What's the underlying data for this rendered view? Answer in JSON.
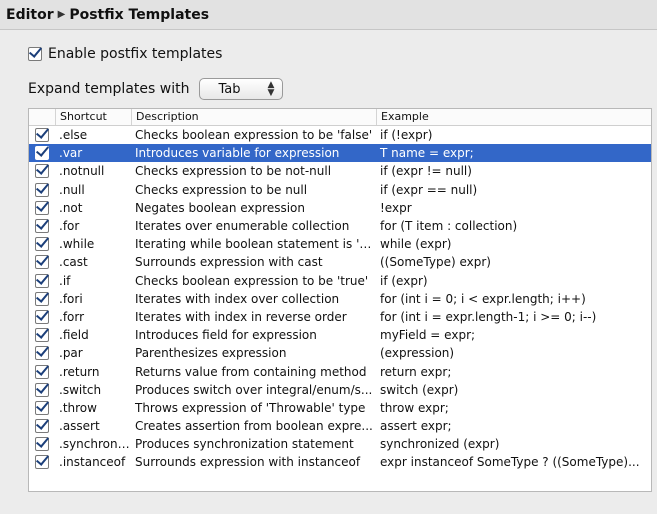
{
  "header": {
    "crumb1": "Editor",
    "crumb2": "Postfix Templates",
    "separator_icon": "triangle-right-icon"
  },
  "enable": {
    "label": "Enable postfix templates",
    "checked": true
  },
  "expand": {
    "label": "Expand templates with",
    "value": "Tab"
  },
  "table": {
    "columns": [
      "",
      "Shortcut",
      "Description",
      "Example"
    ],
    "selected_index": 1,
    "rows": [
      {
        "shortcut": ".else",
        "description": "Checks boolean expression to be 'false'",
        "example": "if (!expr)"
      },
      {
        "shortcut": ".var",
        "description": "Introduces variable for expression",
        "example": "T name = expr;"
      },
      {
        "shortcut": ".notnull",
        "description": "Checks expression to be not-null",
        "example": "if (expr != null)"
      },
      {
        "shortcut": ".null",
        "description": "Checks expression to be null",
        "example": "if (expr == null)"
      },
      {
        "shortcut": ".not",
        "description": "Negates boolean expression",
        "example": "!expr"
      },
      {
        "shortcut": ".for",
        "description": "Iterates over enumerable collection",
        "example": "for (T item : collection)"
      },
      {
        "shortcut": ".while",
        "description": "Iterating while boolean statement is 'tr...",
        "example": "while (expr)"
      },
      {
        "shortcut": ".cast",
        "description": "Surrounds expression with cast",
        "example": "((SomeType) expr)"
      },
      {
        "shortcut": ".if",
        "description": "Checks boolean expression to be 'true'",
        "example": "if (expr)"
      },
      {
        "shortcut": ".fori",
        "description": "Iterates with index over collection",
        "example": "for (int i = 0; i < expr.length; i++)"
      },
      {
        "shortcut": ".forr",
        "description": "Iterates with index in reverse order",
        "example": "for (int i = expr.length-1; i >= 0; i--)"
      },
      {
        "shortcut": ".field",
        "description": "Introduces field for expression",
        "example": "myField = expr;"
      },
      {
        "shortcut": ".par",
        "description": "Parenthesizes expression",
        "example": "(expression)"
      },
      {
        "shortcut": ".return",
        "description": "Returns value from containing method",
        "example": "return expr;"
      },
      {
        "shortcut": ".switch",
        "description": "Produces switch over integral/enum/s...",
        "example": "switch (expr)"
      },
      {
        "shortcut": ".throw",
        "description": "Throws expression of 'Throwable' type",
        "example": "throw expr;"
      },
      {
        "shortcut": ".assert",
        "description": "Creates assertion from boolean expre...",
        "example": "assert expr;"
      },
      {
        "shortcut": ".synchroni...",
        "description": "Produces synchronization statement",
        "example": "synchronized (expr)"
      },
      {
        "shortcut": ".instanceof",
        "description": "Surrounds expression with instanceof",
        "example": "expr instanceof SomeType ? ((SomeType)..."
      }
    ]
  },
  "colors": {
    "selection": "#3367c8",
    "check": "#1c3f7a"
  }
}
